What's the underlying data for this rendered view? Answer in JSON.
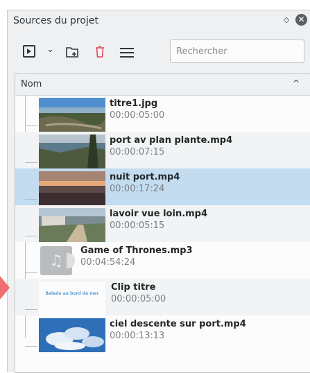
{
  "panel": {
    "title": "Sources du projet",
    "float_glyph": "◇",
    "close_glyph": "✕"
  },
  "toolbar": {
    "buttons": [
      "add-clip-icon",
      "chevron-down-icon",
      "add-folder-icon",
      "delete-icon",
      "hamburger-menu-icon"
    ],
    "chevron_glyph": "⌄",
    "search_placeholder": "Rechercher",
    "search_value": ""
  },
  "list": {
    "header_label": "Nom",
    "sort_glyph": "^",
    "items": [
      {
        "name": "titre1.jpg",
        "duration": "00:00:05:00",
        "type": "image"
      },
      {
        "name": "port av plan plante.mp4",
        "duration": "00:00:07:15",
        "type": "video"
      },
      {
        "name": "nuit port.mp4",
        "duration": "00:00:17:24",
        "type": "video",
        "selected": true
      },
      {
        "name": "lavoir vue loin.mp4",
        "duration": "00:00:05:15",
        "type": "video"
      },
      {
        "name": "Game of Thrones.mp3",
        "duration": "00:04:54:24",
        "type": "audio"
      },
      {
        "name": "Clip titre",
        "duration": "00:00:05:00",
        "type": "title",
        "thumb_text": "Balade au bord de mer"
      },
      {
        "name": "ciel descente sur port.mp4",
        "duration": "00:00:13:13",
        "type": "video"
      }
    ],
    "audio_glyph": "♫"
  },
  "colors": {
    "selection": "#c3dcf0",
    "delete_icon": "#da4453",
    "arrow": "#f06f6f"
  }
}
